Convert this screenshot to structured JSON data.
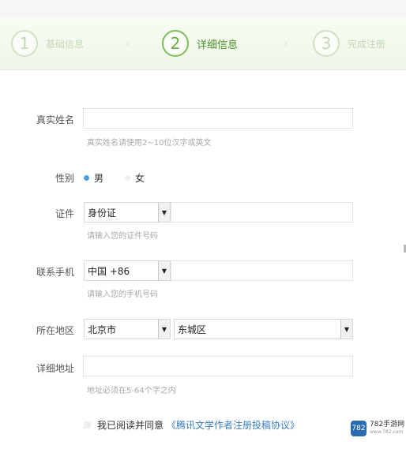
{
  "steps": [
    {
      "num": "1",
      "label": "基础信息"
    },
    {
      "num": "2",
      "label": "详细信息"
    },
    {
      "num": "3",
      "label": "完成注册"
    }
  ],
  "form": {
    "real_name": {
      "label": "真实姓名",
      "value": "",
      "hint": "真实姓名请使用2~10位汉字或英文"
    },
    "gender": {
      "label": "性别",
      "options": [
        "男",
        "女"
      ],
      "selected": "男"
    },
    "id_type": {
      "label": "证件",
      "selected": "身份证",
      "number_value": "",
      "hint": "请输入您的证件号码"
    },
    "phone": {
      "label": "联系手机",
      "country": "中国 +86",
      "value": "",
      "hint": "请输入您的手机号码"
    },
    "region": {
      "label": "所在地区",
      "city": "北京市",
      "district": "东城区"
    },
    "address": {
      "label": "详细地址",
      "value": "",
      "hint": "地址必须在5-64个字之内"
    },
    "agree": {
      "text": "我已阅读并同意",
      "link": "《腾讯文学作者注册投稿协议》"
    }
  },
  "watermark": {
    "logo": "782",
    "text": "782手游网",
    "sub": "www.782.com"
  },
  "colors": {
    "accent_green": "#6aad45",
    "radio_blue": "#4aa3df",
    "link_blue": "#3a7bbf"
  },
  "icons": {
    "select_arrow": "triangle-down"
  }
}
